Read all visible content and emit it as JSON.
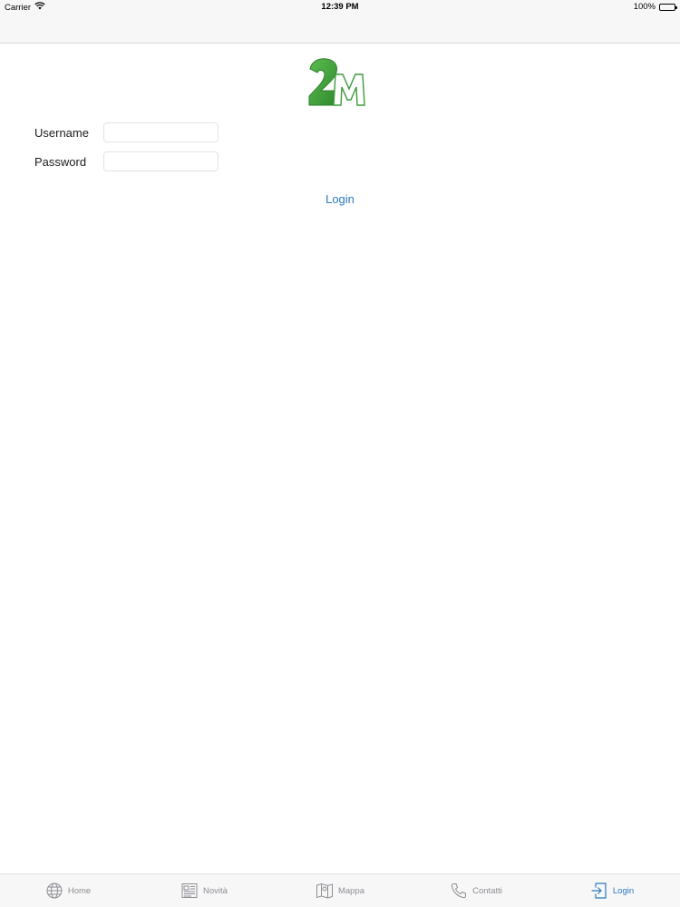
{
  "status_bar": {
    "carrier": "Carrier",
    "time": "12:39 PM",
    "battery": "100%",
    "battery_level": 1.0
  },
  "logo": {
    "text": "2M",
    "green": "#3c9a3a"
  },
  "form": {
    "username_label": "Username",
    "username_value": "",
    "password_label": "Password",
    "password_value": "",
    "login_label": "Login"
  },
  "tab_bar": {
    "items": [
      {
        "label": "Home",
        "icon": "globe-icon",
        "active": false
      },
      {
        "label": "Novità",
        "icon": "newspaper-icon",
        "active": false
      },
      {
        "label": "Mappa",
        "icon": "map-icon",
        "active": false
      },
      {
        "label": "Contatti",
        "icon": "phone-icon",
        "active": false
      },
      {
        "label": "Login",
        "icon": "login-icon",
        "active": true
      }
    ]
  },
  "colors": {
    "accent": "#2b79c2",
    "inactive": "#8e8e93",
    "brand_green": "#3c9a3a"
  }
}
